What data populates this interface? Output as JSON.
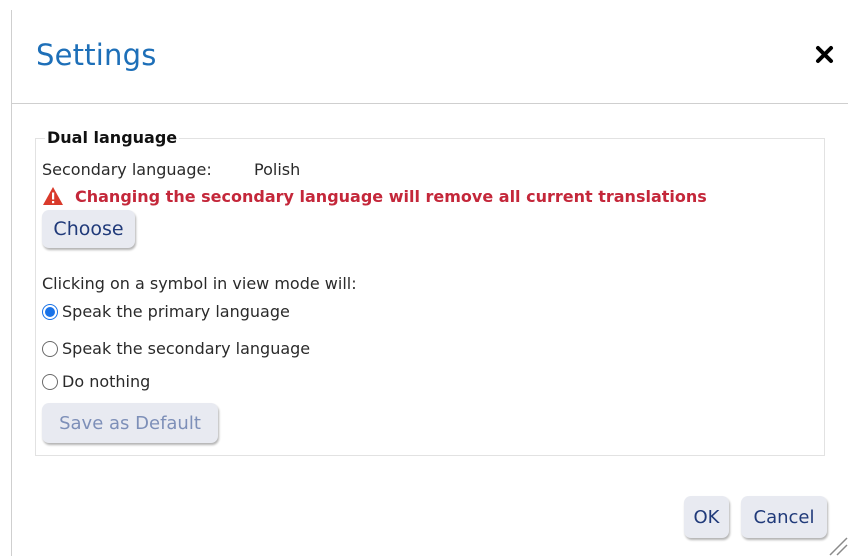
{
  "dialog": {
    "title": "Settings",
    "close_icon": "close-icon"
  },
  "dual_language": {
    "legend": "Dual language",
    "secondary_label": "Secondary language:",
    "secondary_value": "Polish",
    "warning_icon": "warning-icon",
    "warning_text": "Changing the secondary language will remove all current translations",
    "choose_label": "Choose",
    "click_prompt": "Clicking on a symbol in view mode will:",
    "options": [
      {
        "label": "Speak the primary language",
        "checked": true
      },
      {
        "label": "Speak the secondary language",
        "checked": false
      },
      {
        "label": "Do nothing",
        "checked": false
      }
    ],
    "save_default_label": "Save as Default"
  },
  "footer": {
    "ok_label": "OK",
    "cancel_label": "Cancel"
  },
  "colors": {
    "title": "#1d6fb8",
    "warning": "#c4273a",
    "button_bg": "#e8eaf1",
    "button_text": "#203a7a",
    "radio_accent": "#1a73e8"
  }
}
